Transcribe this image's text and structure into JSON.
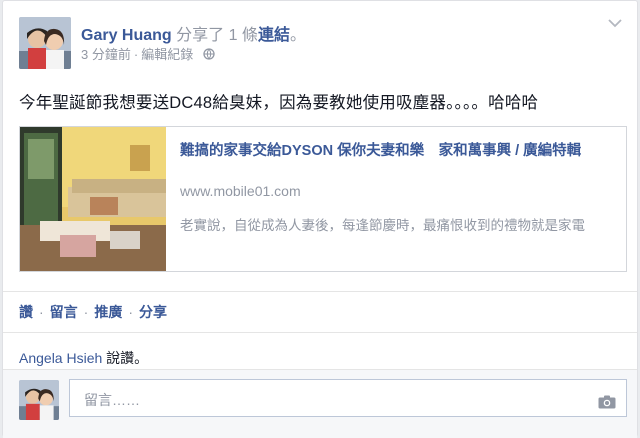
{
  "post": {
    "author": "Gary Huang",
    "verb": "分享了 1 條",
    "verb_link": "連結",
    "period": "。",
    "time": "3 分鐘前",
    "separator": "·",
    "edit_history": "編輯紀錄",
    "privacy_icon": "globe-icon",
    "message": "今年聖誕節我想要送DC48給臭妹，因為要教她使用吸塵器。。。。哈哈哈"
  },
  "link_preview": {
    "title": "難搞的家事交給DYSON 保你夫妻和樂　家和萬事興 / 廣編特輯",
    "domain": "www.mobile01.com",
    "description": "老實說，自從成為人妻後，每逢節慶時，最痛恨收到的禮物就是家電"
  },
  "actions": {
    "like": "讚",
    "comment": "留言",
    "promote": "推廣",
    "share": "分享",
    "dot": "·"
  },
  "likes": {
    "liker": "Angela Hsieh",
    "suffix": " 說讚。"
  },
  "comment": {
    "placeholder": "留言……",
    "camera_icon": "camera-icon"
  },
  "colors": {
    "link_blue": "#3b5998",
    "muted_gray": "#9197a3",
    "text": "#141823",
    "border": "#d3d6db"
  }
}
